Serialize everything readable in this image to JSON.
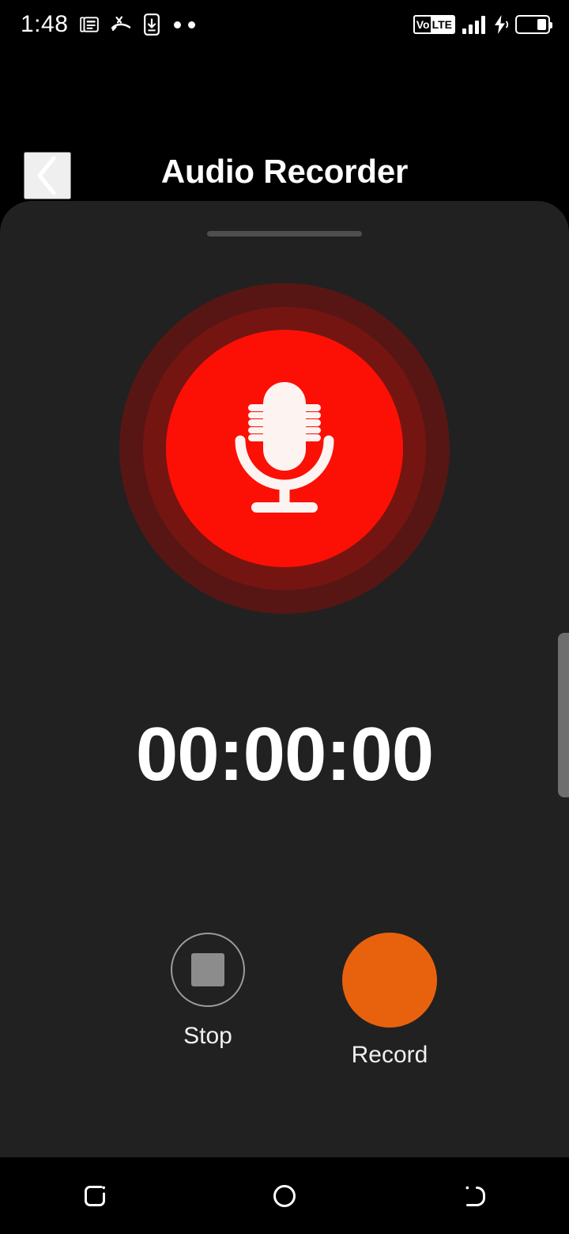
{
  "status_bar": {
    "clock": "1:48",
    "left_icons": [
      {
        "name": "news-document-icon"
      },
      {
        "name": "missed-call-icon"
      },
      {
        "name": "phone-download-icon"
      },
      {
        "name": "more-dots-icon"
      }
    ],
    "volte": {
      "prefix": "Vo",
      "suffix": "LTE"
    },
    "signal": {
      "name": "signal-bars-icon",
      "bars": 4
    },
    "charging": {
      "name": "charging-bolt-icon"
    },
    "battery": {
      "name": "battery-icon",
      "level_percent": 35
    }
  },
  "app_bar": {
    "back": {
      "name": "back-chevron-icon",
      "label": "Back"
    },
    "title": "Audio Recorder"
  },
  "sheet": {
    "handle": "drag-handle",
    "mic": {
      "name": "microphone-icon",
      "label": "Microphone",
      "state": "idle",
      "button_color": "#fc1005",
      "ring_colors": [
        "#571614",
        "#751512",
        "#8e1410"
      ]
    },
    "timer": "00:00:00",
    "controls": {
      "stop": {
        "label": "Stop",
        "icon": "stop-square-icon",
        "enabled": true
      },
      "record": {
        "label": "Record",
        "icon": "record-circle-icon",
        "color": "#e8620e",
        "enabled": true
      }
    },
    "scrollbar": {
      "name": "vertical-scrollbar"
    }
  },
  "nav_bar": {
    "recents": {
      "name": "recents-icon",
      "label": "Recents"
    },
    "home": {
      "name": "home-icon",
      "label": "Home"
    },
    "back": {
      "name": "back-icon",
      "label": "Back"
    }
  },
  "colors": {
    "page_background": "#000000",
    "sheet_background": "#212121",
    "accent_record": "#e8620e",
    "accent_mic": "#fc1005",
    "text_primary": "#ffffff"
  }
}
